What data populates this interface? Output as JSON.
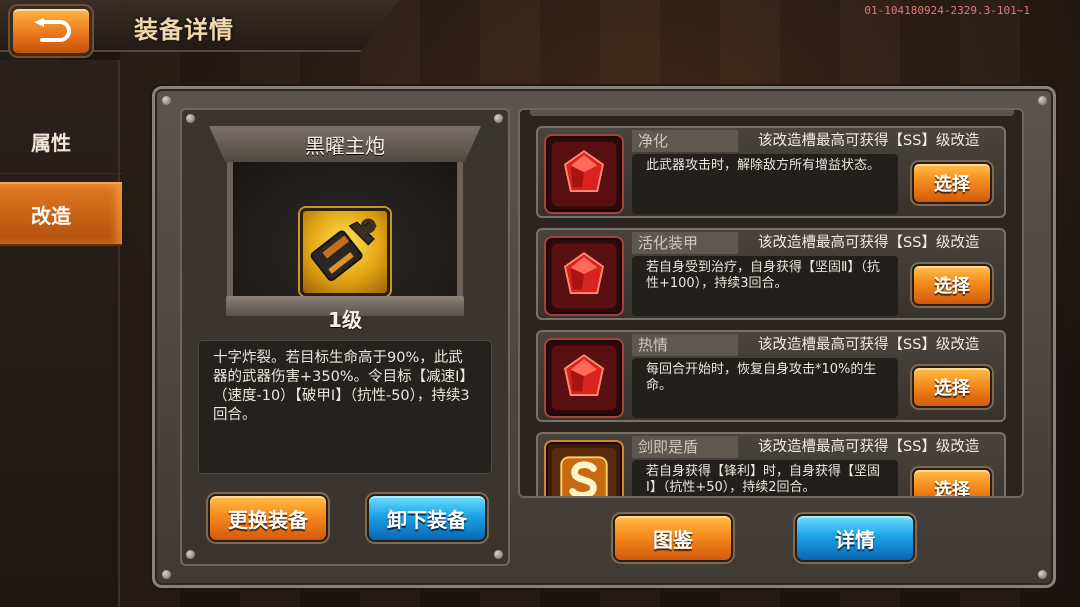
{
  "header": {
    "title": "装备详情",
    "version": "01-104180924-2329.3-101~1",
    "back_icon": "back-arrow-icon"
  },
  "tabs": [
    {
      "label": "属性",
      "active": false
    },
    {
      "label": "改造",
      "active": true
    }
  ],
  "equipment": {
    "name": "黑曜主炮",
    "level": "1级",
    "icon": "cannon-wrench-icon",
    "description": "十字炸裂。若目标生命高于90%，此武器的武器伤害+350%。令目标【减速Ⅰ】（速度-10）【破甲Ⅰ】（抗性-50），持续3回合。"
  },
  "buttons": {
    "change": "更换装备",
    "unload": "卸下装备",
    "atlas": "图鉴",
    "detail": "详情"
  },
  "slots": [
    {
      "icon": "red-gem-icon",
      "title": "净化",
      "header": "该改造槽最高可获得【SS】级改造",
      "desc": "此武器攻击时，解除敌方所有增益状态。",
      "button": "选择"
    },
    {
      "icon": "red-gem-icon",
      "title": "活化装甲",
      "header": "该改造槽最高可获得【SS】级改造",
      "desc": "若自身受到治疗，自身获得【坚固Ⅱ】（抗性+100），持续3回合。",
      "button": "选择"
    },
    {
      "icon": "red-gem-icon",
      "title": "热情",
      "header": "该改造槽最高可获得【SS】级改造",
      "desc": "每回合开始时，恢复自身攻击*10%的生命。",
      "button": "选择"
    },
    {
      "icon": "s-rank-icon",
      "title": "剑即是盾",
      "header": "该改造槽最高可获得【SS】级改造",
      "desc": "若自身获得【锋利】时，自身获得【坚固Ⅰ】（抗性+50），持续2回合。",
      "button": "选择"
    }
  ],
  "colors": {
    "accent_orange": "#f58a1c",
    "accent_blue": "#1ba3e6",
    "panel_bg": "#403a35"
  }
}
